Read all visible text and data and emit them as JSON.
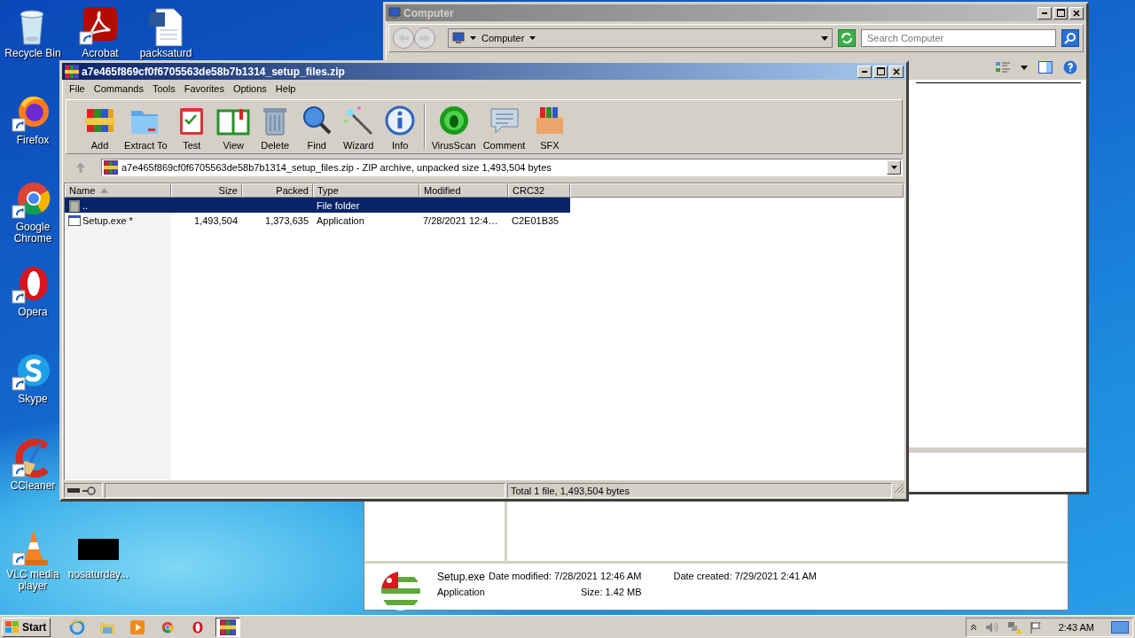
{
  "desktop_icons": [
    {
      "label": "Recycle Bin",
      "kind": "recycle",
      "shortcut": false
    },
    {
      "label": "Acrobat",
      "kind": "pdf",
      "shortcut": true
    },
    {
      "label": "packsaturd",
      "kind": "doc",
      "shortcut": false
    },
    {
      "label": "Firefox",
      "kind": "firefox",
      "shortcut": true
    },
    {
      "label": "Google Chrome",
      "kind": "chrome",
      "shortcut": true
    },
    {
      "label": "Opera",
      "kind": "opera",
      "shortcut": true
    },
    {
      "label": "Skype",
      "kind": "skype",
      "shortcut": true
    },
    {
      "label": "CCleaner",
      "kind": "ccleaner",
      "shortcut": true
    },
    {
      "label": "VLC media player",
      "kind": "vlc",
      "shortcut": true
    },
    {
      "label": "nosaturday...",
      "kind": "thumb",
      "shortcut": false
    }
  ],
  "explorer": {
    "title": "Computer",
    "address": "Computer",
    "search_placeholder": "Search Computer"
  },
  "details_pane": {
    "name": "Setup.exe",
    "type": "Application",
    "date_modified_label": "Date modified:",
    "date_modified": "7/28/2021 12:46 AM",
    "date_created_label": "Date created:",
    "date_created": "7/29/2021 2:41 AM",
    "size_label": "Size:",
    "size": "1.42 MB"
  },
  "winrar": {
    "title": "a7e465f869cf0f6705563de58b7b1314_setup_files.zip",
    "menu": [
      "File",
      "Commands",
      "Tools",
      "Favorites",
      "Options",
      "Help"
    ],
    "toolbar": [
      {
        "label": "Add",
        "kind": "add"
      },
      {
        "label": "Extract To",
        "kind": "extract"
      },
      {
        "label": "Test",
        "kind": "test"
      },
      {
        "label": "View",
        "kind": "view"
      },
      {
        "label": "Delete",
        "kind": "delete"
      },
      {
        "label": "Find",
        "kind": "find"
      },
      {
        "label": "Wizard",
        "kind": "wizard"
      },
      {
        "label": "Info",
        "kind": "info"
      },
      {
        "label": "VirusScan",
        "kind": "virus"
      },
      {
        "label": "Comment",
        "kind": "comment"
      },
      {
        "label": "SFX",
        "kind": "sfx"
      }
    ],
    "path": "a7e465f869cf0f6705563de58b7b1314_setup_files.zip - ZIP archive, unpacked size 1,493,504 bytes",
    "columns": [
      {
        "label": "Name",
        "sorted": true
      },
      {
        "label": "Size",
        "sorted": false
      },
      {
        "label": "Packed",
        "sorted": false
      },
      {
        "label": "Type",
        "sorted": false
      },
      {
        "label": "Modified",
        "sorted": false
      },
      {
        "label": "CRC32",
        "sorted": false
      }
    ],
    "rows": [
      {
        "kind": "folder",
        "selected": true,
        "cells": [
          "..",
          "",
          "",
          "File folder",
          "",
          ""
        ]
      },
      {
        "kind": "exe",
        "selected": false,
        "cells": [
          "Setup.exe *",
          "1,493,504",
          "1,373,635",
          "Application",
          "7/28/2021 12:4…",
          "C2E01B35"
        ]
      }
    ],
    "status": "Total 1 file, 1,493,504 bytes"
  },
  "taskbar": {
    "start": "Start",
    "apps": [
      {
        "kind": "ie",
        "active": false
      },
      {
        "kind": "explorer",
        "active": false
      },
      {
        "kind": "media",
        "active": false
      },
      {
        "kind": "chrome",
        "active": false
      },
      {
        "kind": "opera",
        "active": false
      },
      {
        "kind": "winrar",
        "active": true
      }
    ],
    "clock": "2:43 AM"
  }
}
